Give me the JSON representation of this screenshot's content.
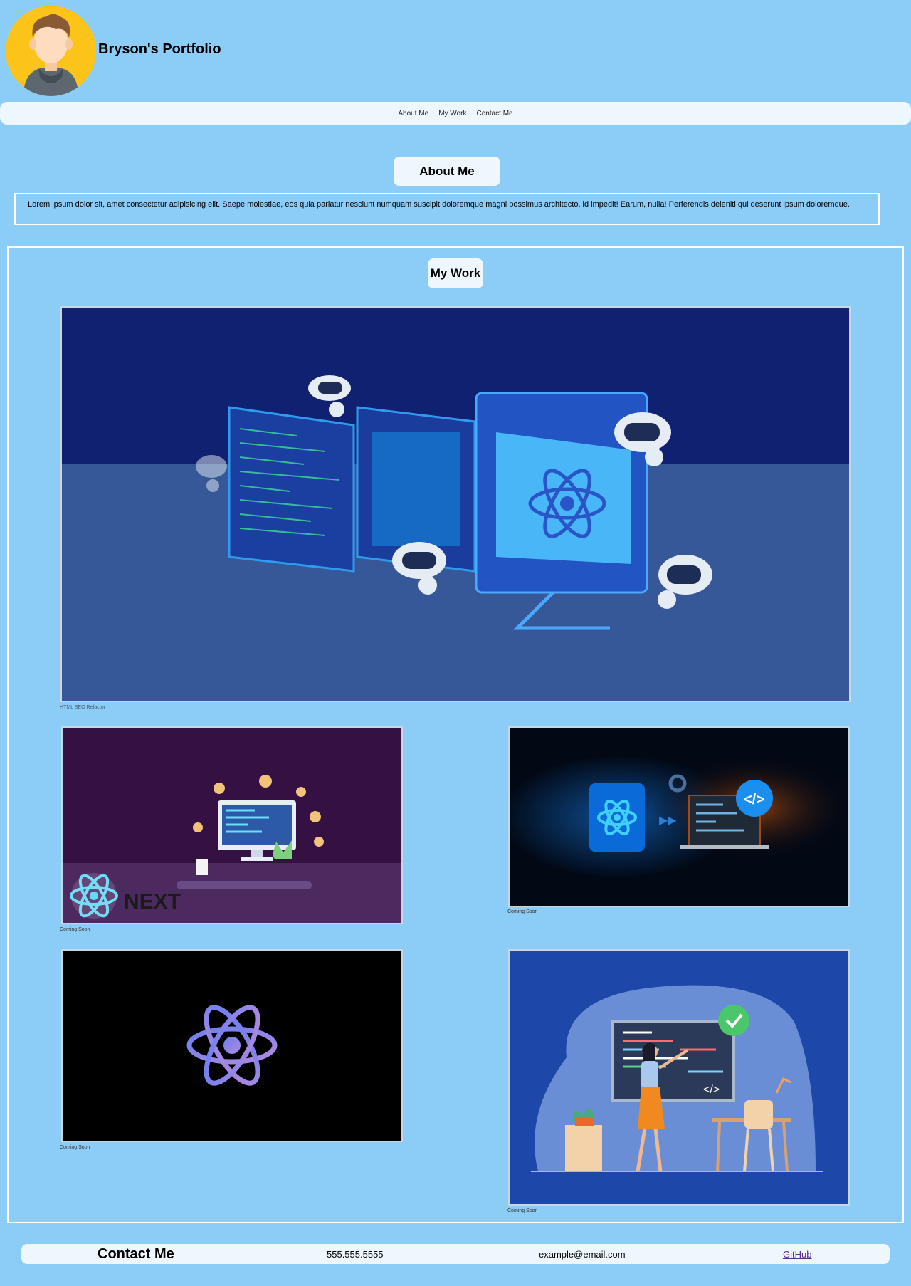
{
  "header": {
    "title": "Bryson's Portfolio",
    "avatar_icon": "developer-avatar-icon"
  },
  "nav": {
    "items": [
      "About Me",
      "My Work",
      "Contact Me"
    ]
  },
  "about": {
    "title": "About Me",
    "text": "Lorem ipsum dolor sit, amet consectetur adipisicing elit. Saepe molestiae, eos quia pariatur nesciunt numquam suscipit doloremque magni possimus architecto, id impedit! Earum, nulla! Perferendis deleniti qui deserunt ipsum doloremque."
  },
  "work": {
    "title": "My Work",
    "projects": [
      {
        "caption": "HTML SEO Refactor",
        "image": "react-robots-illustration"
      },
      {
        "caption": "Coming Soon",
        "image": "react-next-illustration"
      },
      {
        "caption": "Coming Soon",
        "image": "react-laptop-illustration"
      },
      {
        "caption": "Coming Soon",
        "image": "react-logo-black"
      },
      {
        "caption": "Coming Soon",
        "image": "teacher-board-illustration"
      }
    ]
  },
  "contact": {
    "title": "Contact Me",
    "phone": "555.555.5555",
    "email": "example@email.com",
    "github_label": "GitHub"
  },
  "colors": {
    "page_bg": "#8ccdf8",
    "panel_bg": "#eef7fd",
    "accent_yellow": "#fcc419"
  }
}
